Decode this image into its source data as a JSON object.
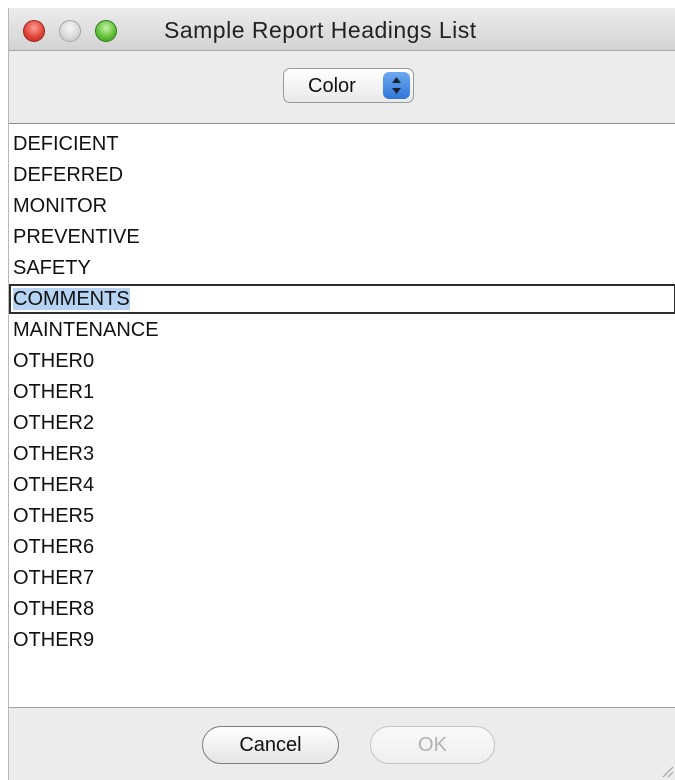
{
  "window": {
    "title": "Sample Report Headings List"
  },
  "toolbar": {
    "select_value": "Color",
    "select_icon": "up-down-arrows-icon"
  },
  "list": {
    "items": [
      "DEFICIENT",
      "DEFERRED",
      "MONITOR",
      "PREVENTIVE",
      "SAFETY",
      "COMMENTS",
      "MAINTENANCE",
      "OTHER0",
      "OTHER1",
      "OTHER2",
      "OTHER3",
      "OTHER4",
      "OTHER5",
      "OTHER6",
      "OTHER7",
      "OTHER8",
      "OTHER9"
    ],
    "selected": "COMMENTS"
  },
  "footer": {
    "cancel_label": "Cancel",
    "ok_label": "OK"
  },
  "colors": {
    "selection_highlight": "#b6d3f3",
    "stepper_blue": "#3b82e0",
    "close_red": "#e0443a",
    "zoom_green": "#62c23a"
  }
}
